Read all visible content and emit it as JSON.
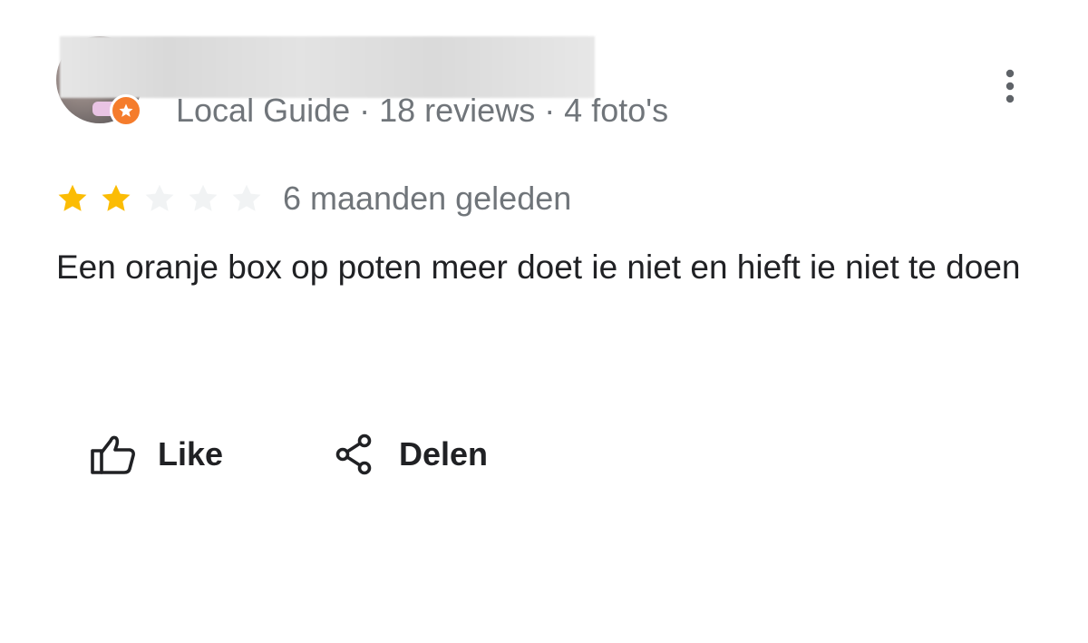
{
  "reviewer": {
    "meta": "Local Guide · 18 reviews · 4 foto's",
    "avatar_icon": "user-avatar",
    "badge_icon": "local-guide-star-icon",
    "badge_color": "#f57c2c"
  },
  "menu": {
    "icon": "more-vertical-icon"
  },
  "rating": {
    "stars": 2,
    "max_stars": 5,
    "star_color": "#fbbc04",
    "empty_star_color": "#f1f3f4",
    "date": "6 maanden geleden"
  },
  "review": {
    "text": "Een oranje box op poten meer doet ie niet en hieft ie niet te doen"
  },
  "actions": {
    "like_label": "Like",
    "like_icon": "thumbs-up-icon",
    "share_label": "Delen",
    "share_icon": "share-icon"
  }
}
